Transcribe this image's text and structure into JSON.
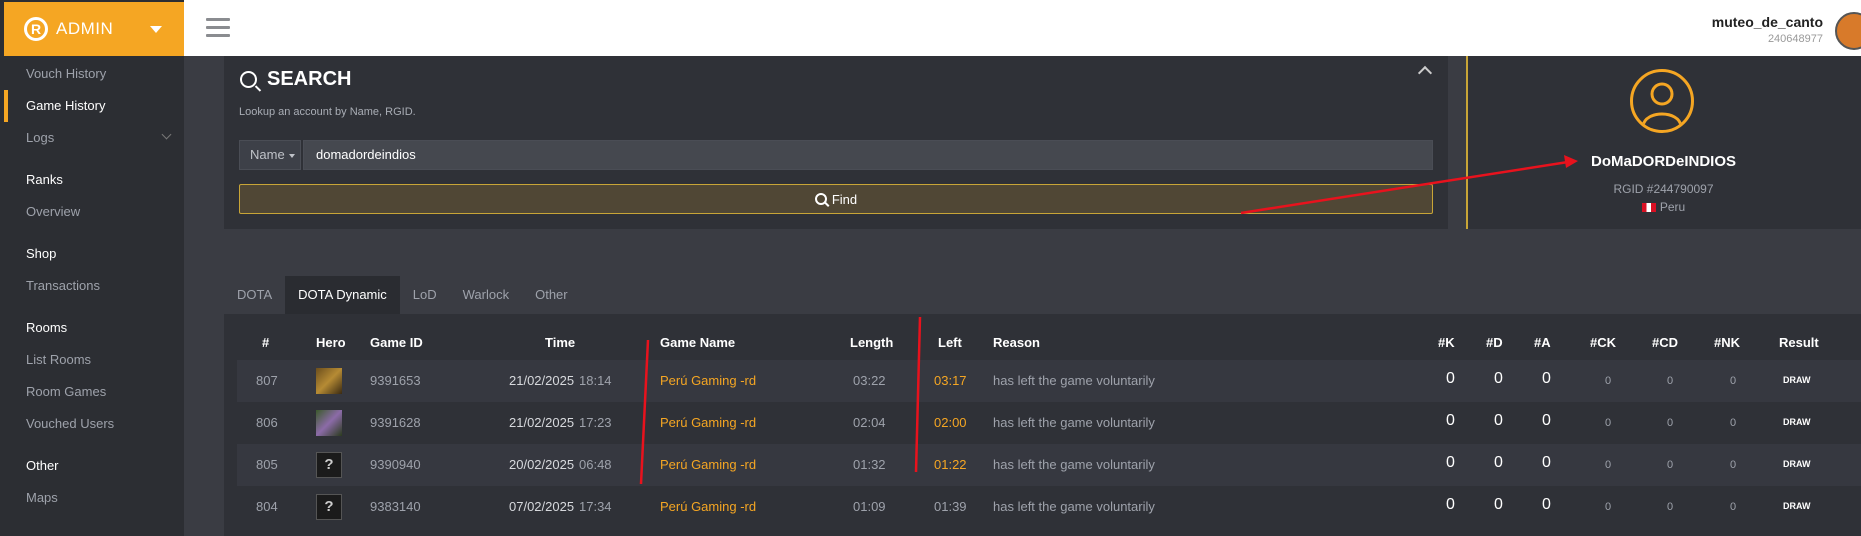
{
  "brand": {
    "label": "ADMIN",
    "logo_letter": "R",
    "accent": "#f5a623"
  },
  "sidebar": {
    "items": [
      {
        "label": "Vouch History",
        "type": "item"
      },
      {
        "label": "Game History",
        "type": "item",
        "active": true
      },
      {
        "label": "Logs",
        "type": "item",
        "expandable": true
      },
      {
        "label": "Ranks",
        "type": "heading"
      },
      {
        "label": "Overview",
        "type": "item"
      },
      {
        "label": "Shop",
        "type": "heading"
      },
      {
        "label": "Transactions",
        "type": "item"
      },
      {
        "label": "Rooms",
        "type": "heading"
      },
      {
        "label": "List Rooms",
        "type": "item"
      },
      {
        "label": "Room Games",
        "type": "item"
      },
      {
        "label": "Vouched Users",
        "type": "item"
      },
      {
        "label": "Other",
        "type": "heading"
      },
      {
        "label": "Maps",
        "type": "item"
      }
    ]
  },
  "user": {
    "name": "muteo_de_canto",
    "id": "240648977"
  },
  "search": {
    "title": "SEARCH",
    "subtitle": "Lookup an account by Name, RGID.",
    "field_type": "Name",
    "value": "domadordeindios",
    "find_label": "Find"
  },
  "profile": {
    "name": "DoMaDORDeINDIOS",
    "rgid": "RGID #244790097",
    "country": "Peru"
  },
  "tabs": [
    "DOTA",
    "DOTA Dynamic",
    "LoD",
    "Warlock",
    "Other"
  ],
  "active_tab": "DOTA Dynamic",
  "table": {
    "headers": {
      "num": "#",
      "hero": "Hero",
      "game_id": "Game ID",
      "time": "Time",
      "game_name": "Game Name",
      "length": "Length",
      "left": "Left",
      "reason": "Reason",
      "k": "#K",
      "d": "#D",
      "a": "#A",
      "ck": "#CK",
      "cd": "#CD",
      "nk": "#NK",
      "result": "Result"
    },
    "rows": [
      {
        "num": "807",
        "hero": "hero-portrait-1",
        "game_id": "9391653",
        "date": "21/02/2025",
        "time": "18:14",
        "game_name": "Perú Gaming -rd",
        "length": "03:22",
        "left": "03:17",
        "left_highlight": true,
        "reason": "has left the game voluntarily",
        "k": "0",
        "d": "0",
        "a": "0",
        "ck": "0",
        "cd": "0",
        "nk": "0",
        "result": "DRAW"
      },
      {
        "num": "806",
        "hero": "hero-portrait-2",
        "game_id": "9391628",
        "date": "21/02/2025",
        "time": "17:23",
        "game_name": "Perú Gaming -rd",
        "length": "02:04",
        "left": "02:00",
        "left_highlight": true,
        "reason": "has left the game voluntarily",
        "k": "0",
        "d": "0",
        "a": "0",
        "ck": "0",
        "cd": "0",
        "nk": "0",
        "result": "DRAW"
      },
      {
        "num": "805",
        "hero": "unknown-hero",
        "game_id": "9390940",
        "date": "20/02/2025",
        "time": "06:48",
        "game_name": "Perú Gaming -rd",
        "length": "01:32",
        "left": "01:22",
        "left_highlight": true,
        "reason": "has left the game voluntarily",
        "k": "0",
        "d": "0",
        "a": "0",
        "ck": "0",
        "cd": "0",
        "nk": "0",
        "result": "DRAW"
      },
      {
        "num": "804",
        "hero": "unknown-hero",
        "game_id": "9383140",
        "date": "07/02/2025",
        "time": "17:34",
        "game_name": "Perú Gaming -rd",
        "length": "01:09",
        "left": "01:39",
        "left_highlight": false,
        "reason": "has left the game voluntarily",
        "k": "0",
        "d": "0",
        "a": "0",
        "ck": "0",
        "cd": "0",
        "nk": "0",
        "result": "DRAW"
      }
    ]
  },
  "annotation_color": "#e8121d"
}
